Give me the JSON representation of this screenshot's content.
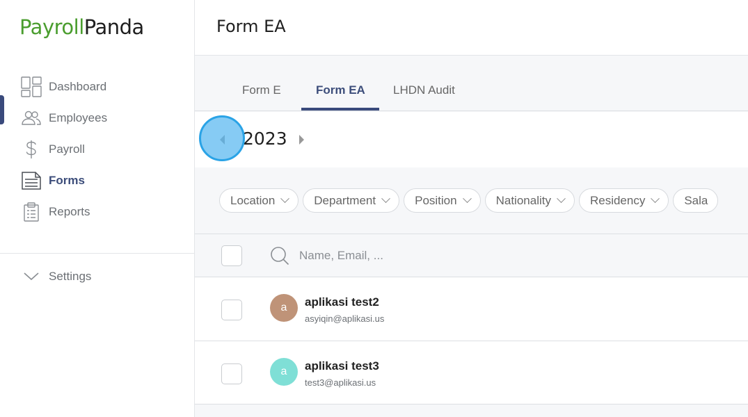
{
  "app": {
    "logo_part1": "Payroll",
    "logo_part2": "Panda"
  },
  "sidebar": {
    "items": [
      {
        "label": "Dashboard",
        "icon": "dashboard-icon",
        "active": false
      },
      {
        "label": "Employees",
        "icon": "users-icon",
        "active": false
      },
      {
        "label": "Payroll",
        "icon": "dollar-icon",
        "active": false
      },
      {
        "label": "Forms",
        "icon": "document-icon",
        "active": true
      },
      {
        "label": "Reports",
        "icon": "clipboard-icon",
        "active": false
      }
    ],
    "settings_label": "Settings"
  },
  "header": {
    "title": "Form EA"
  },
  "tabs": [
    {
      "label": "Form E"
    },
    {
      "label": "Form EA"
    },
    {
      "label": "LHDN Audit"
    }
  ],
  "year_selector": {
    "year": "2023"
  },
  "filters": [
    "Location",
    "Department",
    "Position",
    "Nationality",
    "Residency",
    "Sala"
  ],
  "search": {
    "placeholder": "Name, Email, ..."
  },
  "employees": [
    {
      "initial": "a",
      "name": "aplikasi test2",
      "email": "asyiqin@aplikasi.us",
      "avatar_color": "#bf9378"
    },
    {
      "initial": "a",
      "name": "aplikasi test3",
      "email": "test3@aplikasi.us",
      "avatar_color": "#7fdfd6"
    }
  ],
  "colors": {
    "brand_green": "#4a9d2e",
    "accent_navy": "#3a4a7c"
  }
}
